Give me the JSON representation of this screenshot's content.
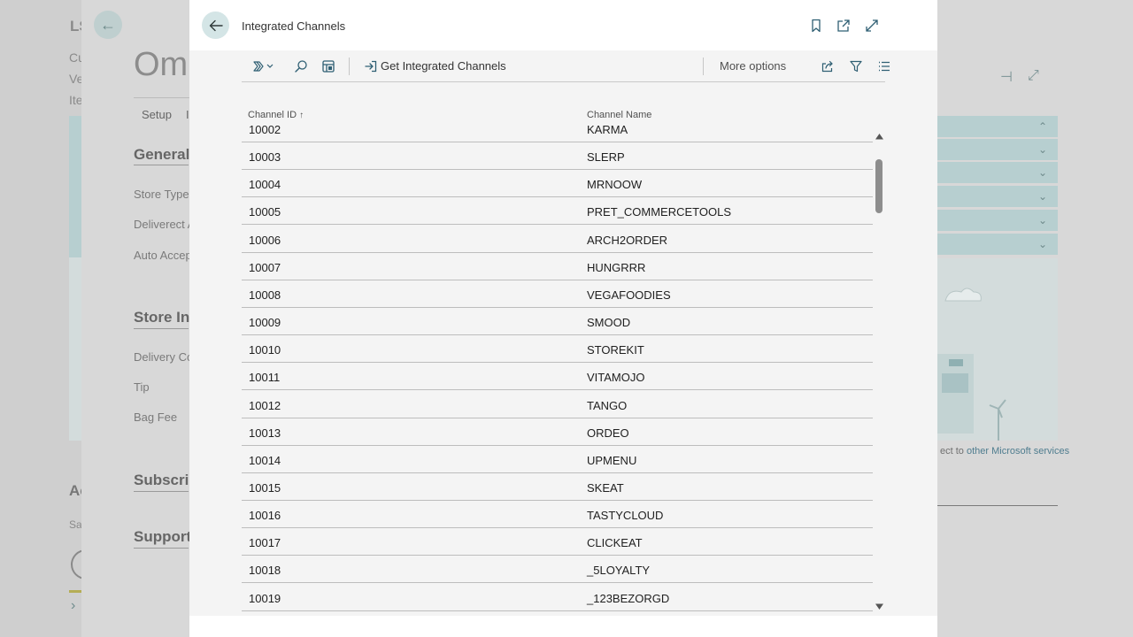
{
  "background": {
    "left_snippets": [
      "LS",
      "Cu",
      "Ve",
      "Ite",
      "Ac",
      "Sal"
    ],
    "title": "Omn",
    "tab": "Setup",
    "tab_extra": "I",
    "sections": [
      "General",
      "Store Inc",
      "Subscript",
      "Support"
    ],
    "fields": [
      "Store Type",
      "Deliverect A",
      "Auto Accep",
      "Delivery Co",
      "Tip",
      "Bag Fee"
    ],
    "link_prefix": "ect to ",
    "link_text": "other Microsoft services"
  },
  "modal": {
    "title": "Integrated Channels",
    "toolbar": {
      "get_label": "Get Integrated Channels",
      "more_label": "More options"
    },
    "columns": {
      "id": "Channel ID",
      "sort_indicator": "↑",
      "name": "Channel Name"
    },
    "rows": [
      {
        "id": "10002",
        "name": "KARMA"
      },
      {
        "id": "10003",
        "name": "SLERP"
      },
      {
        "id": "10004",
        "name": "MRNOOW"
      },
      {
        "id": "10005",
        "name": "PRET_COMMERCETOOLS"
      },
      {
        "id": "10006",
        "name": "ARCH2ORDER"
      },
      {
        "id": "10007",
        "name": "HUNGRRR"
      },
      {
        "id": "10008",
        "name": "VEGAFOODIES"
      },
      {
        "id": "10009",
        "name": "SMOOD"
      },
      {
        "id": "10010",
        "name": "STOREKIT"
      },
      {
        "id": "10011",
        "name": "VITAMOJO"
      },
      {
        "id": "10012",
        "name": "TANGO"
      },
      {
        "id": "10013",
        "name": "ORDEO"
      },
      {
        "id": "10014",
        "name": "UPMENU"
      },
      {
        "id": "10015",
        "name": "SKEAT"
      },
      {
        "id": "10016",
        "name": "TASTYCLOUD"
      },
      {
        "id": "10017",
        "name": "CLICKEAT"
      },
      {
        "id": "10018",
        "name": "_5LOYALTY"
      },
      {
        "id": "10019",
        "name": "_123BEZORGD"
      }
    ]
  },
  "colors": {
    "accent": "#d4e5e6",
    "icon": "#2f5f73"
  }
}
